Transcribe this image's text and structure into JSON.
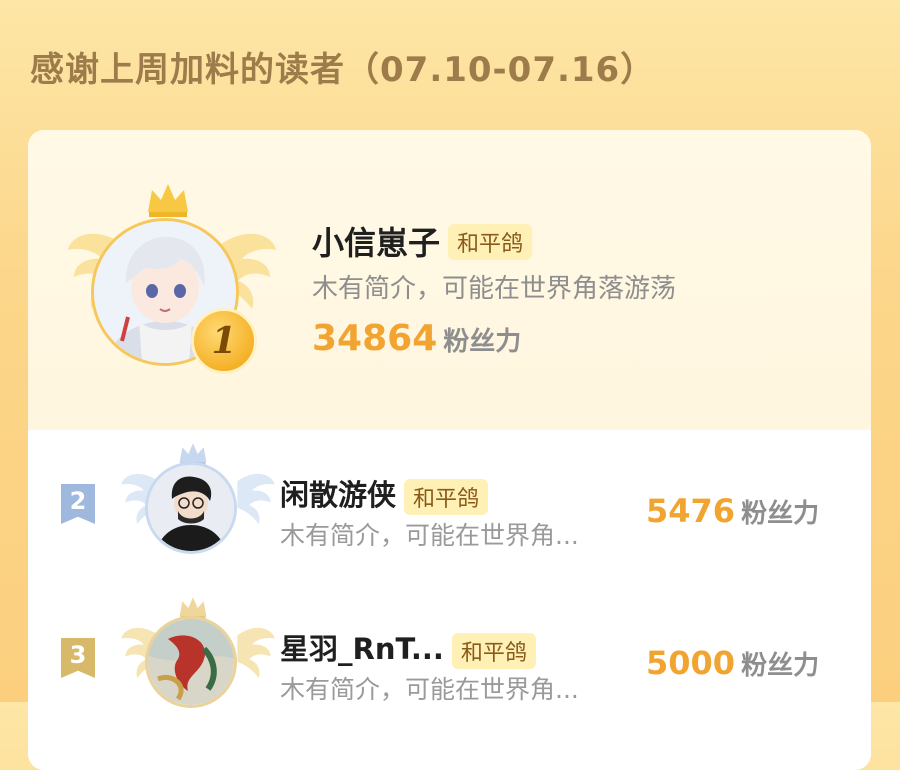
{
  "header": {
    "title": "感谢上周加料的读者（07.10-07.16）"
  },
  "ranking": [
    {
      "rank": "1",
      "name": "小信崽子",
      "tag": "和平鸽",
      "bio": "木有简介，可能在世界角落游荡",
      "score": "34864",
      "unit": "粉丝力"
    },
    {
      "rank": "2",
      "name": "闲散游侠",
      "tag": "和平鸽",
      "bio": "木有简介，可能在世界角...",
      "score": "5476",
      "unit": "粉丝力"
    },
    {
      "rank": "3",
      "name": "星羽_RnT...",
      "tag": "和平鸽",
      "bio": "木有简介，可能在世界角...",
      "score": "5000",
      "unit": "粉丝力"
    }
  ],
  "colors": {
    "accent": "#f2a431",
    "tag_bg": "#fff0b5",
    "rank2": "#9fb8de",
    "rank3": "#d8b96a"
  }
}
